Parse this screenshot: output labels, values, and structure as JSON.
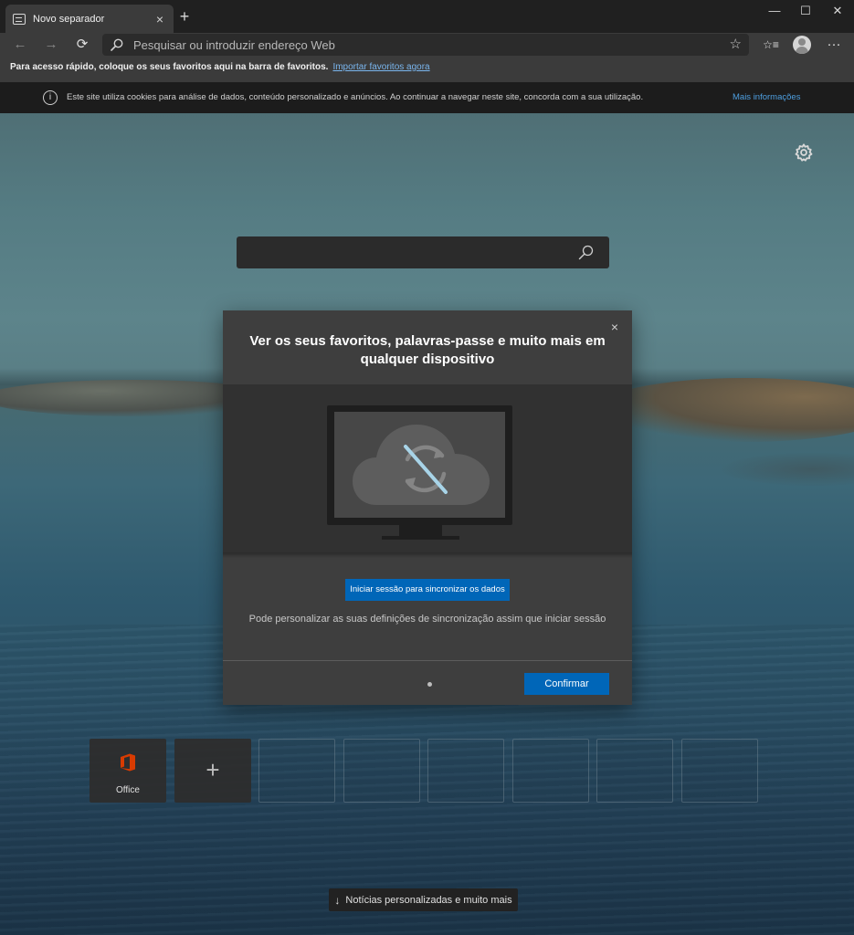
{
  "browser": {
    "tab_title": "Novo separador",
    "tab_close": "×",
    "new_tab": "+",
    "window_controls": {
      "minimize": "—",
      "maximize": "☐",
      "close": "✕"
    },
    "nav": {
      "back": "←",
      "forward": "→",
      "refresh": "⟳"
    },
    "address_placeholder": "Pesquisar ou introduzir endereço Web",
    "favorite_star": "☆",
    "favorites_icon": "☆≡",
    "more_menu": "···"
  },
  "favorites_bar": {
    "text": "Para acesso rápido, coloque os seus favoritos aqui na barra de favoritos.",
    "import_link": "Importar favoritos agora"
  },
  "cookie_banner": {
    "icon": "i",
    "text": "Este site utiliza cookies para análise de dados, conteúdo personalizado e anúncios. Ao continuar a navegar neste site, concorda com a sua utilização.",
    "more_info": "Mais informações"
  },
  "dialog": {
    "title": "Ver os seus favoritos, palavras-passe e muito mais em qualquer dispositivo",
    "close": "×",
    "signin_button": "Iniciar sessão para sincronizar os dados",
    "hint": "Pode personalizar as suas definições de sincronização assim que iniciar sessão",
    "confirm_button": "Confirmar"
  },
  "top_sites": [
    {
      "label": "Office",
      "type": "site"
    },
    {
      "label": "+",
      "type": "add"
    },
    {
      "label": "",
      "type": "empty"
    },
    {
      "label": "",
      "type": "empty"
    },
    {
      "label": "",
      "type": "empty"
    },
    {
      "label": "",
      "type": "empty"
    },
    {
      "label": "",
      "type": "empty"
    },
    {
      "label": "",
      "type": "empty"
    }
  ],
  "news_button": {
    "arrow": "↓",
    "label": "Notícias personalizadas e muito mais"
  },
  "colors": {
    "accent": "#0066b8",
    "link": "#7ab6ee",
    "office_red": "#d83b01"
  },
  "icons": [
    "tab-favicon-icon",
    "search-icon",
    "star-icon",
    "favorites-icon",
    "profile-icon",
    "more-icon",
    "info-icon",
    "settings-gear-icon",
    "search-icon",
    "sync-off-icon",
    "office-icon",
    "add-icon",
    "arrow-down-icon"
  ]
}
